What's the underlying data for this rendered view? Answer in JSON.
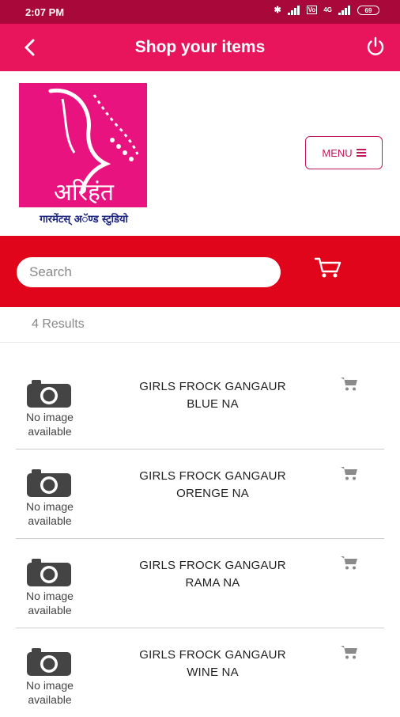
{
  "status_bar": {
    "time": "2:07 PM",
    "network": "4G",
    "volte": "Vo",
    "battery": "69"
  },
  "app_bar": {
    "title": "Shop your items",
    "color": "#e8155d"
  },
  "brand": {
    "logo_text": "अरिहंत",
    "logo_subtext": "गारमेंटस् अॅण्ड स्टुडियो",
    "menu_label": "MENU",
    "accent": "#c2185b"
  },
  "search": {
    "placeholder": "Search",
    "value": "",
    "bar_color": "#e0051b"
  },
  "results_label": "4 Results",
  "products": [
    {
      "line1": "GIRLS FROCK GANGAUR",
      "line2": "BLUE NA",
      "image_line1": "No image",
      "image_line2": "available"
    },
    {
      "line1": "GIRLS FROCK GANGAUR",
      "line2": "ORENGE NA",
      "image_line1": "No image",
      "image_line2": "available"
    },
    {
      "line1": "GIRLS FROCK GANGAUR",
      "line2": "RAMA NA",
      "image_line1": "No image",
      "image_line2": "available"
    },
    {
      "line1": "GIRLS FROCK GANGAUR",
      "line2": "WINE NA",
      "image_line1": "No image",
      "image_line2": "available"
    }
  ],
  "icons": [
    "back-arrow-icon",
    "power-icon",
    "menu-icon",
    "cart-icon",
    "camera-icon"
  ]
}
